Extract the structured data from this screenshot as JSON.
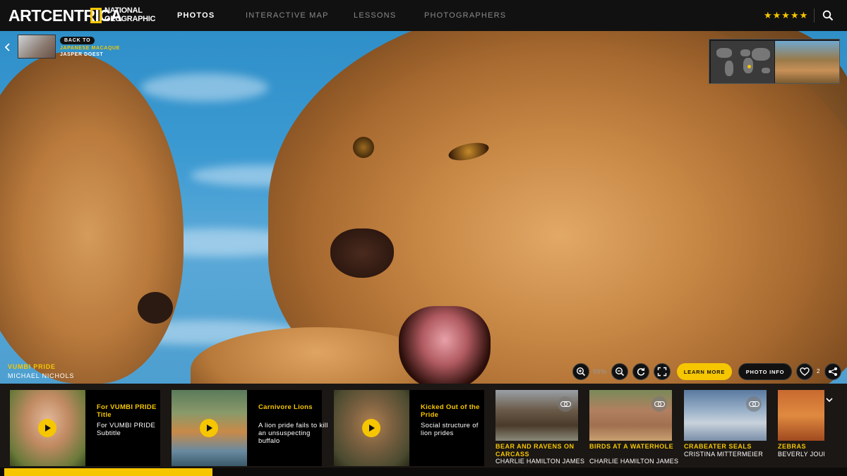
{
  "brand": {
    "logo": "ARTCENTRICA",
    "partner_line1": "NATIONAL",
    "partner_line2": "GEOGRAPHIC"
  },
  "nav": [
    {
      "label": "PHOTOS",
      "active": true
    },
    {
      "label": "INTERACTIVE MAP",
      "active": false
    },
    {
      "label": "LESSONS",
      "active": false
    },
    {
      "label": "PHOTOGRAPHERS",
      "active": false
    }
  ],
  "rating": {
    "stars": "★★★★★",
    "value": 5
  },
  "back": {
    "pill": "BACK TO",
    "title": "JAPANESE MACAQUE",
    "author": "JASPER DOEST"
  },
  "photo": {
    "title": "VUMBI PRIDE",
    "photographer": "MICHAEL NICHOLS"
  },
  "controls": {
    "zoom": "99%",
    "learn_more": "LEARN MORE",
    "photo_info": "PHOTO INFO",
    "likes": "2"
  },
  "videos": [
    {
      "title": "For VUMBI PRIDE Title",
      "subtitle": "For VUMBI PRIDE Subtitle"
    },
    {
      "title": "Carnivore Lions",
      "subtitle": "A lion pride fails to kill an unsuspecting buffalo"
    },
    {
      "title": "Kicked Out of the Pride",
      "subtitle": "Social structure of lion prides"
    }
  ],
  "related": [
    {
      "title": "BEAR AND RAVENS ON CARCASS",
      "author": "CHARLIE HAMILTON JAMES"
    },
    {
      "title": "BIRDS AT A WATERHOLE",
      "author": "CHARLIE HAMILTON JAMES"
    },
    {
      "title": "CRABEATER SEALS",
      "author": "CRISTINA MITTERMEIER"
    },
    {
      "title": "ZEBRAS",
      "author": "BEVERLY JOUBERT"
    }
  ],
  "colors": {
    "accent": "#f6c600",
    "nav_bg": "#111111",
    "strip_bg": "#1b1714"
  },
  "icons": [
    "search-icon",
    "zoom-in-icon",
    "zoom-out-icon",
    "rotate-icon",
    "fullscreen-icon",
    "heart-icon",
    "share-icon",
    "play-icon",
    "link-icon",
    "chevron-left-icon",
    "chevron-down-icon"
  ]
}
